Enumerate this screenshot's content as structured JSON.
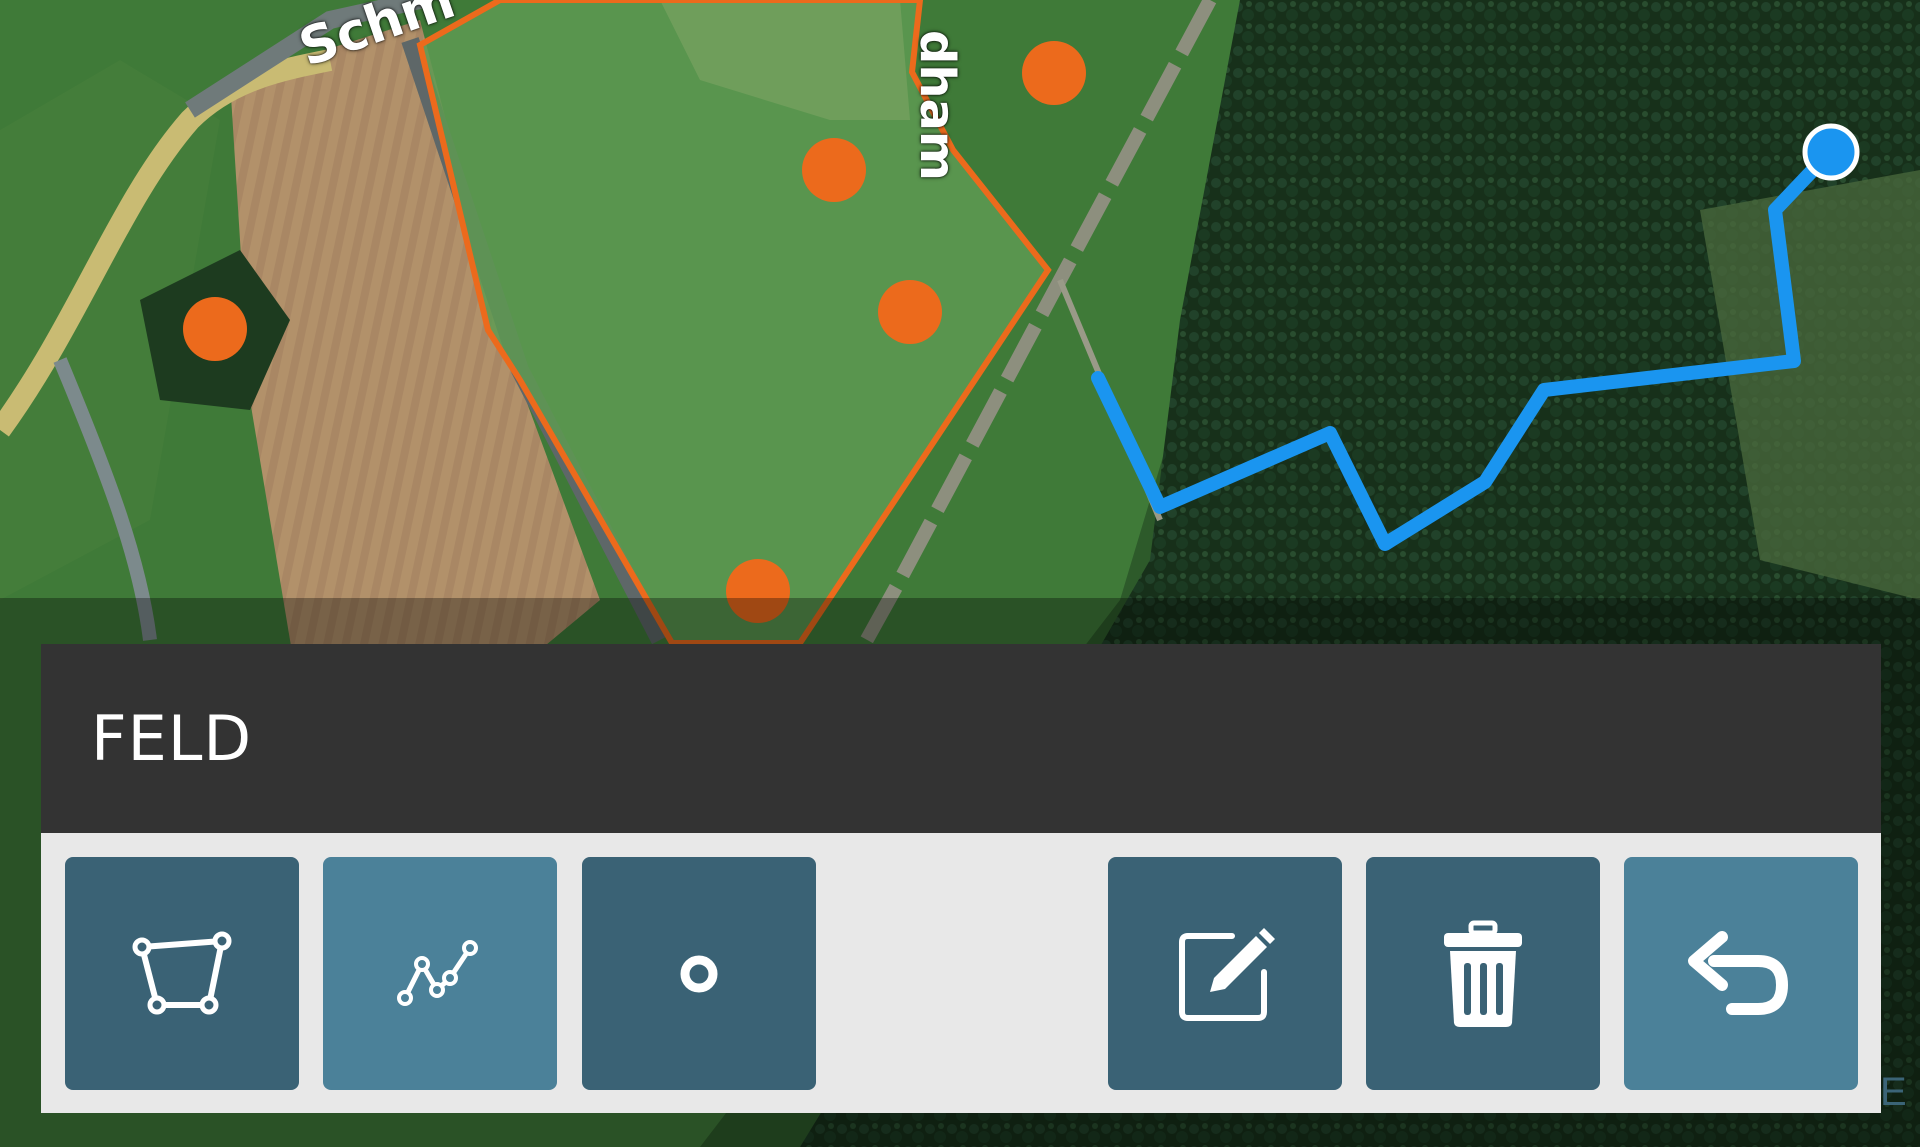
{
  "map": {
    "street_labels": [
      "Schm",
      "dham"
    ],
    "colors": {
      "area_fill": "#5e9a52",
      "area_outline": "#ec6a1c",
      "point_marker": "#ec6a1c",
      "route_line": "#1a95f0",
      "route_end": "#1a95f0"
    }
  },
  "panel": {
    "title": "FELD",
    "tools": [
      {
        "name": "polygon-icon",
        "label": ""
      },
      {
        "name": "polyline-icon",
        "label": ""
      },
      {
        "name": "point-icon",
        "label": ""
      },
      {
        "name": "edit-icon",
        "label": ""
      },
      {
        "name": "trash-icon",
        "label": ""
      },
      {
        "name": "undo-icon",
        "label": ""
      }
    ],
    "colors": {
      "header_bg": "#333333",
      "toolbar_bg": "#e8e8e8",
      "button_dark": "#3a6275",
      "button_light": "#4b8199"
    }
  },
  "corner_text": "E"
}
